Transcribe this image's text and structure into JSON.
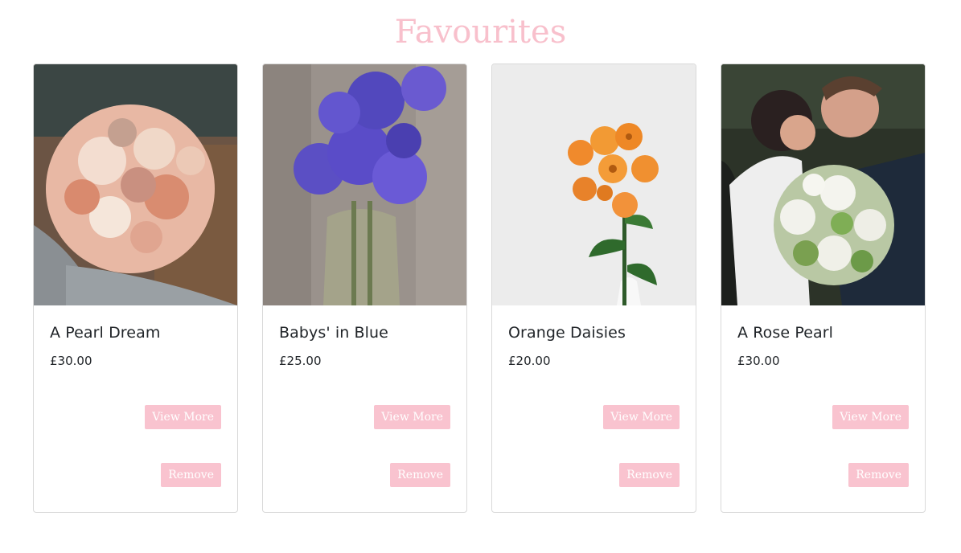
{
  "page": {
    "title": "Favourites"
  },
  "buttons": {
    "view_more": "View More",
    "remove": "Remove"
  },
  "products": [
    {
      "name": "A Pearl Dream",
      "price": "£30.00",
      "image": "peach-rose-bouquet"
    },
    {
      "name": "Babys' in Blue",
      "price": "£25.00",
      "image": "blue-flowers-in-vase"
    },
    {
      "name": "Orange Daisies",
      "price": "£20.00",
      "image": "orange-daisy-stem"
    },
    {
      "name": "A Rose Pearl",
      "price": "£30.00",
      "image": "wedding-couple-white-roses"
    }
  ],
  "colors": {
    "accent": "#f9c3cf",
    "title": "#f8c0cc",
    "card_border": "#d9d9d9"
  }
}
